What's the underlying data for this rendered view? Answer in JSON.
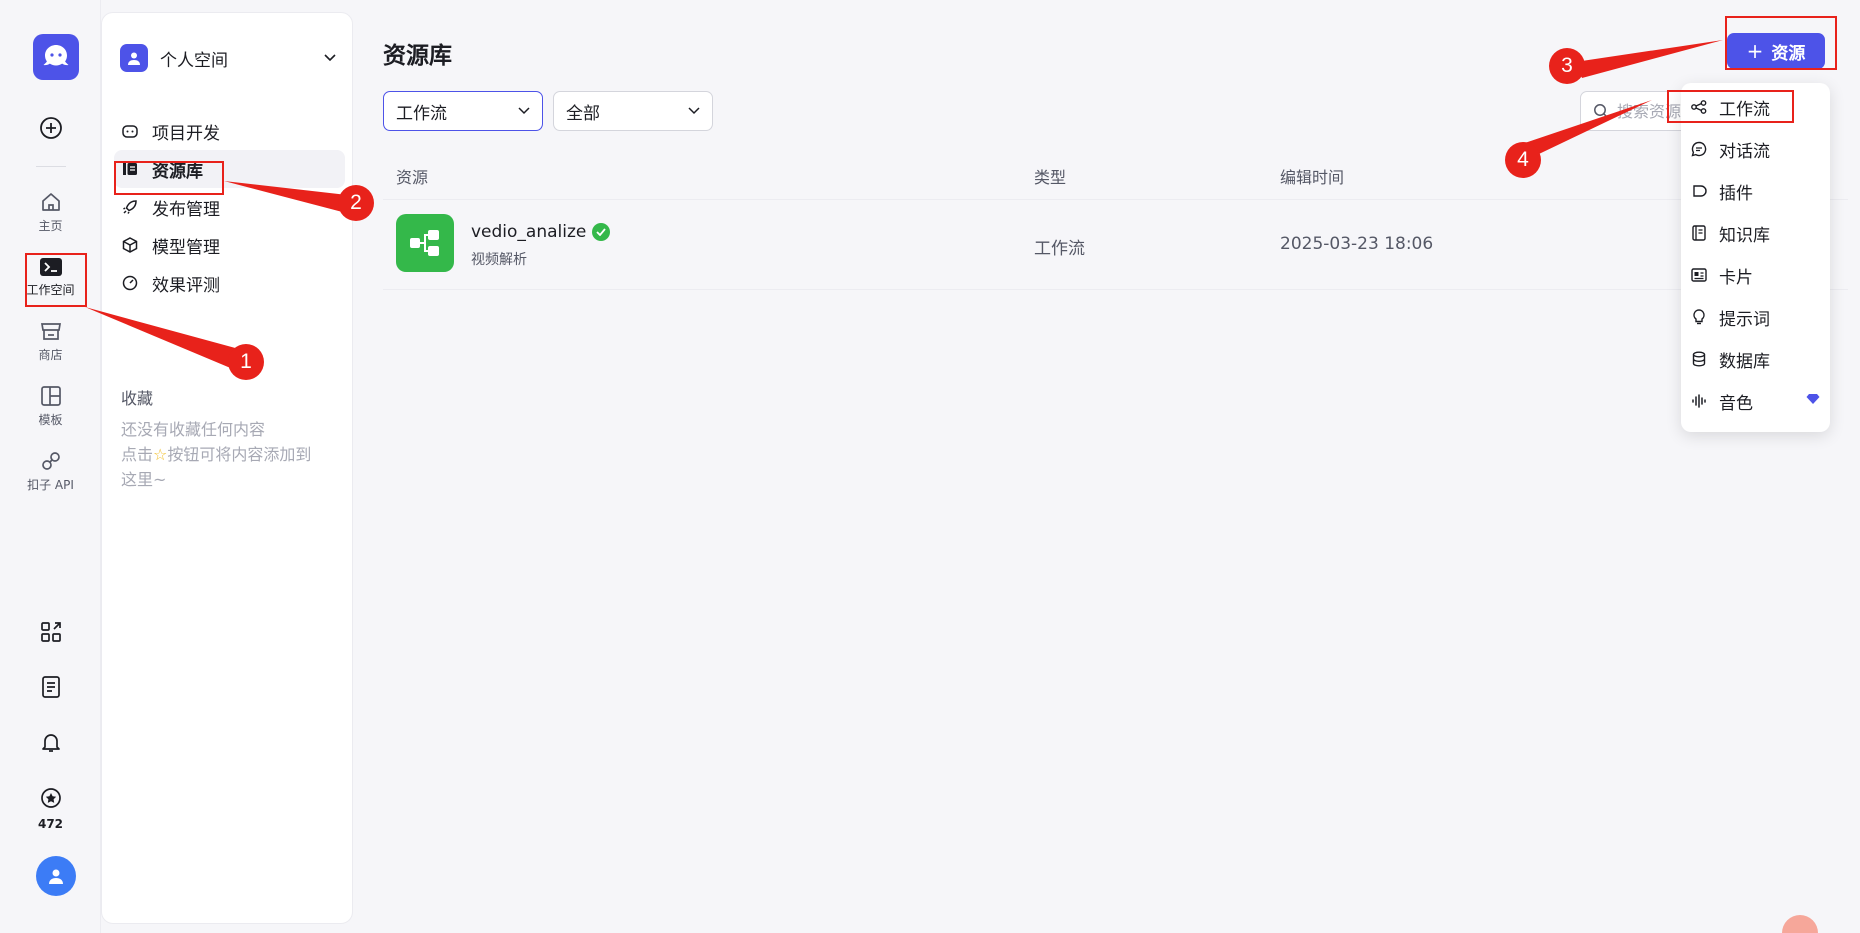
{
  "rail": {
    "items": [
      {
        "label": "",
        "icon": "plus-circle-icon"
      },
      {
        "label": "主页",
        "icon": "home-icon"
      },
      {
        "label": "工作空间",
        "icon": "terminal-icon"
      },
      {
        "label": "商店",
        "icon": "store-icon"
      },
      {
        "label": "模板",
        "icon": "template-icon"
      },
      {
        "label": "扣子 API",
        "icon": "api-icon"
      }
    ],
    "bottom_icons": [
      "apps-icon",
      "docs-icon",
      "bell-icon",
      "credits-icon"
    ],
    "credits": "472"
  },
  "sidebar": {
    "space_name": "个人空间",
    "items": [
      {
        "label": "项目开发",
        "icon": "robot-icon"
      },
      {
        "label": "资源库",
        "icon": "library-icon"
      },
      {
        "label": "发布管理",
        "icon": "rocket-icon"
      },
      {
        "label": "模型管理",
        "icon": "cube-icon"
      },
      {
        "label": "效果评测",
        "icon": "gauge-icon"
      }
    ],
    "favorites_title": "收藏",
    "favorites_hint_1": "还没有收藏任何内容",
    "favorites_hint_2a": "点击",
    "favorites_hint_2b": "按钮可将内容添加到",
    "favorites_hint_3": "这里~"
  },
  "main": {
    "title": "资源库",
    "filter_type": "工作流",
    "filter_scope": "全部",
    "search_placeholder": "搜索资源",
    "add_button": "资源",
    "columns": [
      "资源",
      "类型",
      "编辑时间"
    ],
    "rows": [
      {
        "name": "vedio_analize",
        "desc": "视频解析",
        "type": "工作流",
        "time": "2025-03-23 18:06"
      }
    ]
  },
  "dropdown": {
    "items": [
      {
        "label": "工作流",
        "icon": "workflow-icon"
      },
      {
        "label": "对话流",
        "icon": "chatflow-icon"
      },
      {
        "label": "插件",
        "icon": "plugin-icon"
      },
      {
        "label": "知识库",
        "icon": "knowledge-icon"
      },
      {
        "label": "卡片",
        "icon": "card-icon"
      },
      {
        "label": "提示词",
        "icon": "prompt-icon"
      },
      {
        "label": "数据库",
        "icon": "database-icon"
      },
      {
        "label": "音色",
        "icon": "voice-icon"
      }
    ]
  },
  "annotations": [
    "1",
    "2",
    "3",
    "4"
  ],
  "colors": {
    "accent": "#4d53e8",
    "annotation": "#e8221b",
    "success": "#34b84a"
  }
}
